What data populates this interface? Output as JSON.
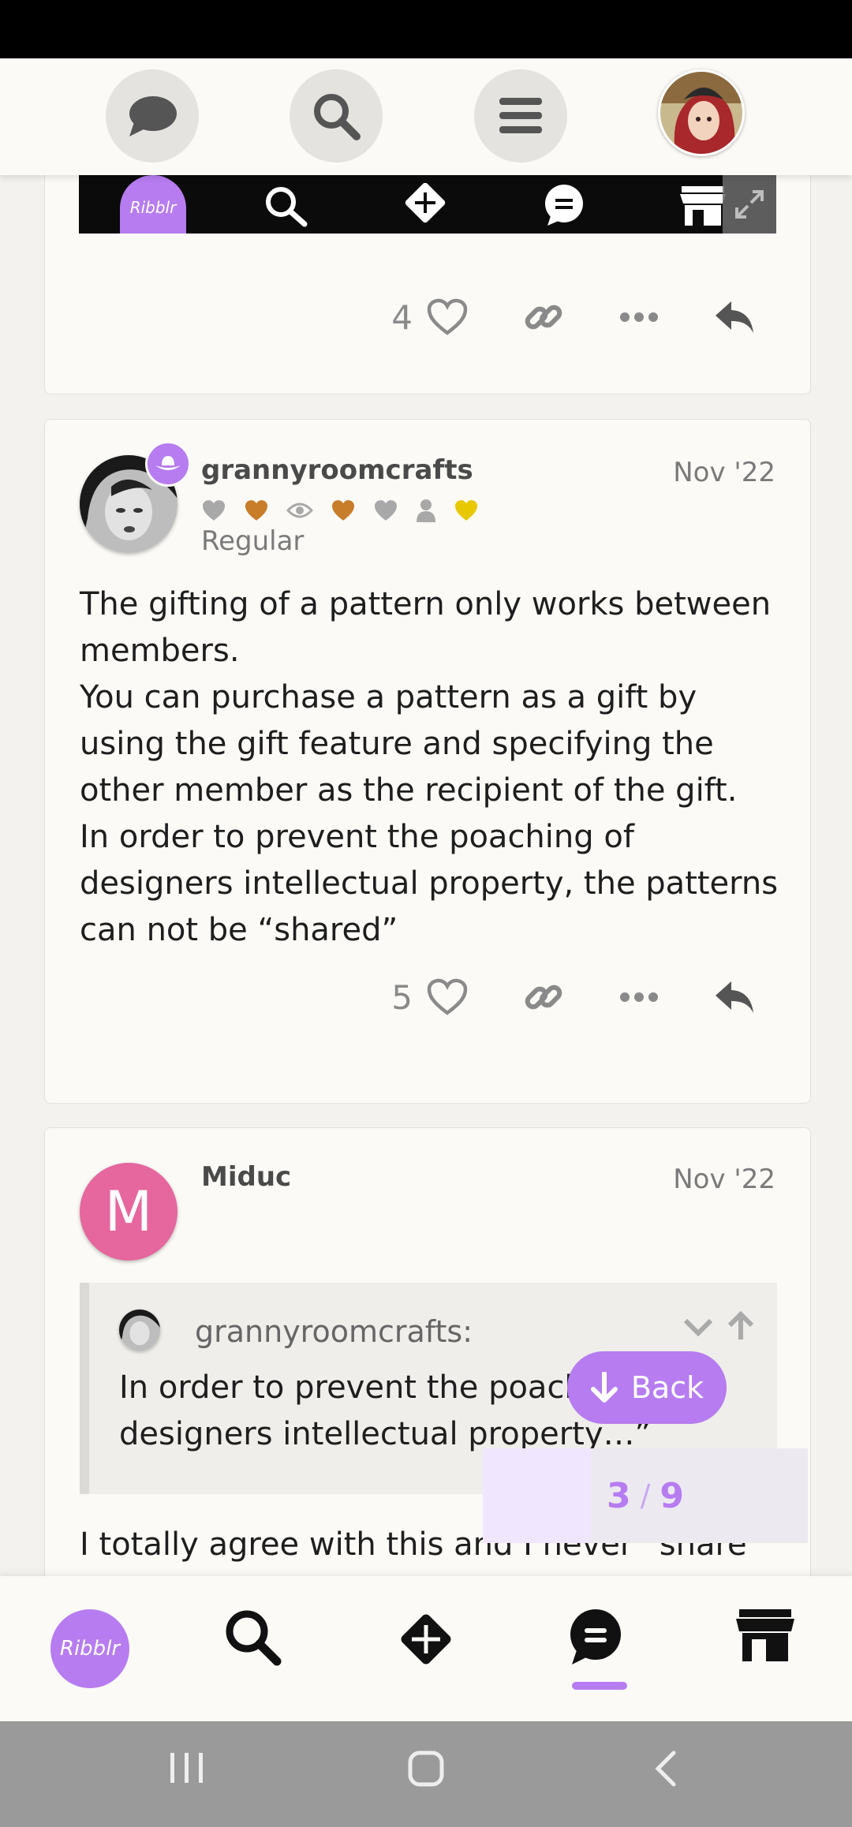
{
  "header": {
    "chat_label": "chat",
    "search_label": "search",
    "menu_label": "menu",
    "avatar_label": "user avatar"
  },
  "embed": {
    "logo_text": "Ribblr"
  },
  "posts": [
    {
      "like_count": "4"
    },
    {
      "author": "grannyroomcrafts",
      "date": "Nov '22",
      "user_title": "Regular",
      "paragraphs": [
        "The gifting of a pattern only works between members.",
        "You can purchase a pattern as a gift by using the gift feature and specifying the other member as the recipient of the gift.",
        "In order to prevent the poaching of designers intellectual property, the patterns can not be “shared”"
      ],
      "like_count": "5"
    },
    {
      "author": "Miduc",
      "avatar_letter": "M",
      "date": "Nov '22",
      "quote": {
        "author": "grannyroomcrafts:",
        "text": "In order to prevent the poaching of designers intellectual property…”"
      },
      "body_partial": "I totally agree with this and I never “share"
    }
  ],
  "timeline": {
    "back_label": "Back",
    "current": "3",
    "separator": "/",
    "total": "9",
    "progress_fraction": 0.333
  },
  "bottom_nav": {
    "logo_text": "Ribblr",
    "active": "chat"
  },
  "colors": {
    "accent": "#b67cf0",
    "avatar_m": "#e5679d",
    "badge_bronze": "#c87d2b",
    "badge_gold": "#e8c800",
    "badge_grey": "#a8a8a8"
  }
}
